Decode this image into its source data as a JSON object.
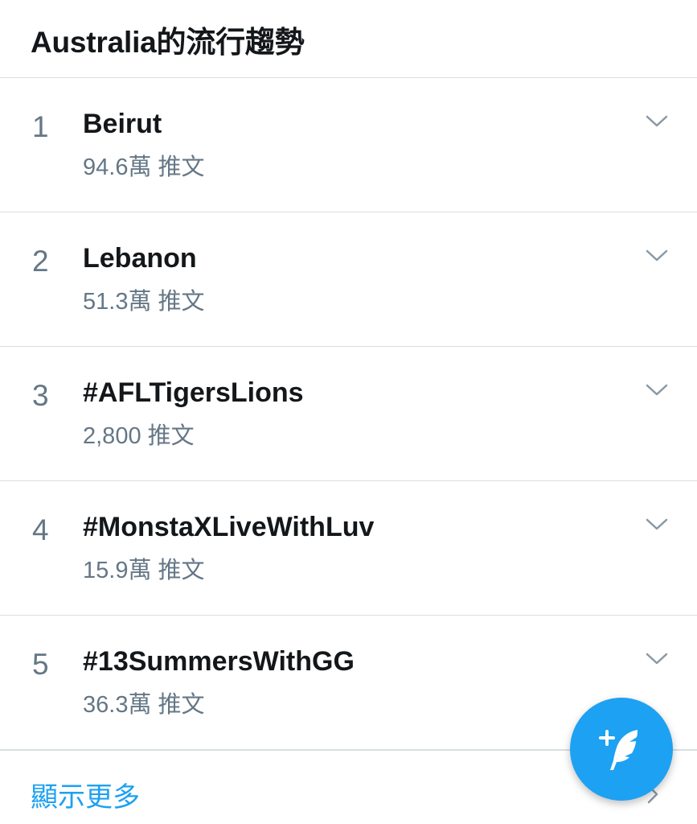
{
  "header": {
    "title": "Australia的流行趨勢"
  },
  "trends": [
    {
      "rank": "1",
      "name": "Beirut",
      "count": "94.6萬 推文"
    },
    {
      "rank": "2",
      "name": "Lebanon",
      "count": "51.3萬 推文"
    },
    {
      "rank": "3",
      "name": "#AFLTigersLions",
      "count": "2,800 推文"
    },
    {
      "rank": "4",
      "name": "#MonstaXLiveWithLuv",
      "count": "15.9萬 推文"
    },
    {
      "rank": "5",
      "name": "#13SummersWithGG",
      "count": "36.3萬 推文"
    }
  ],
  "show_more": {
    "label": "顯示更多"
  },
  "icons": {
    "trend_menu": "chevron-down-icon",
    "show_more": "chevron-right-icon",
    "compose": "compose-tweet-icon"
  },
  "colors": {
    "accent": "#1da1f2",
    "primary_text": "#14171a",
    "secondary_text": "#657786",
    "divider": "#d9dfe3"
  }
}
